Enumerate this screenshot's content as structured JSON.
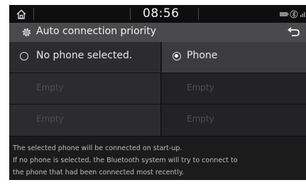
{
  "status_bar": {
    "time": "08:56",
    "icons": [
      "home-icon",
      "battery-icon",
      "bluetooth-icon",
      "signal-icon"
    ]
  },
  "header": {
    "title": "Auto connection priority",
    "icon": "gear-icon",
    "back_icon": "back-icon"
  },
  "options": [
    {
      "label": "No phone selected.",
      "selected": false
    },
    {
      "label": "Phone",
      "selected": true
    }
  ],
  "slots": [
    {
      "label": "Empty"
    },
    {
      "label": "Empty"
    },
    {
      "label": "Empty"
    },
    {
      "label": "Empty"
    }
  ],
  "info": {
    "line1": "The selected phone will be connected on start-up.",
    "line2": "If no phone is selected, the Bluetooth system will try to connect to",
    "line3": "the phone that had been connected most recently."
  },
  "colors": {
    "background": "#1b1b1c",
    "title_bar": "#4a4a4c",
    "selected_cell": "#3c3c3e",
    "text": "#f2f2f2"
  }
}
